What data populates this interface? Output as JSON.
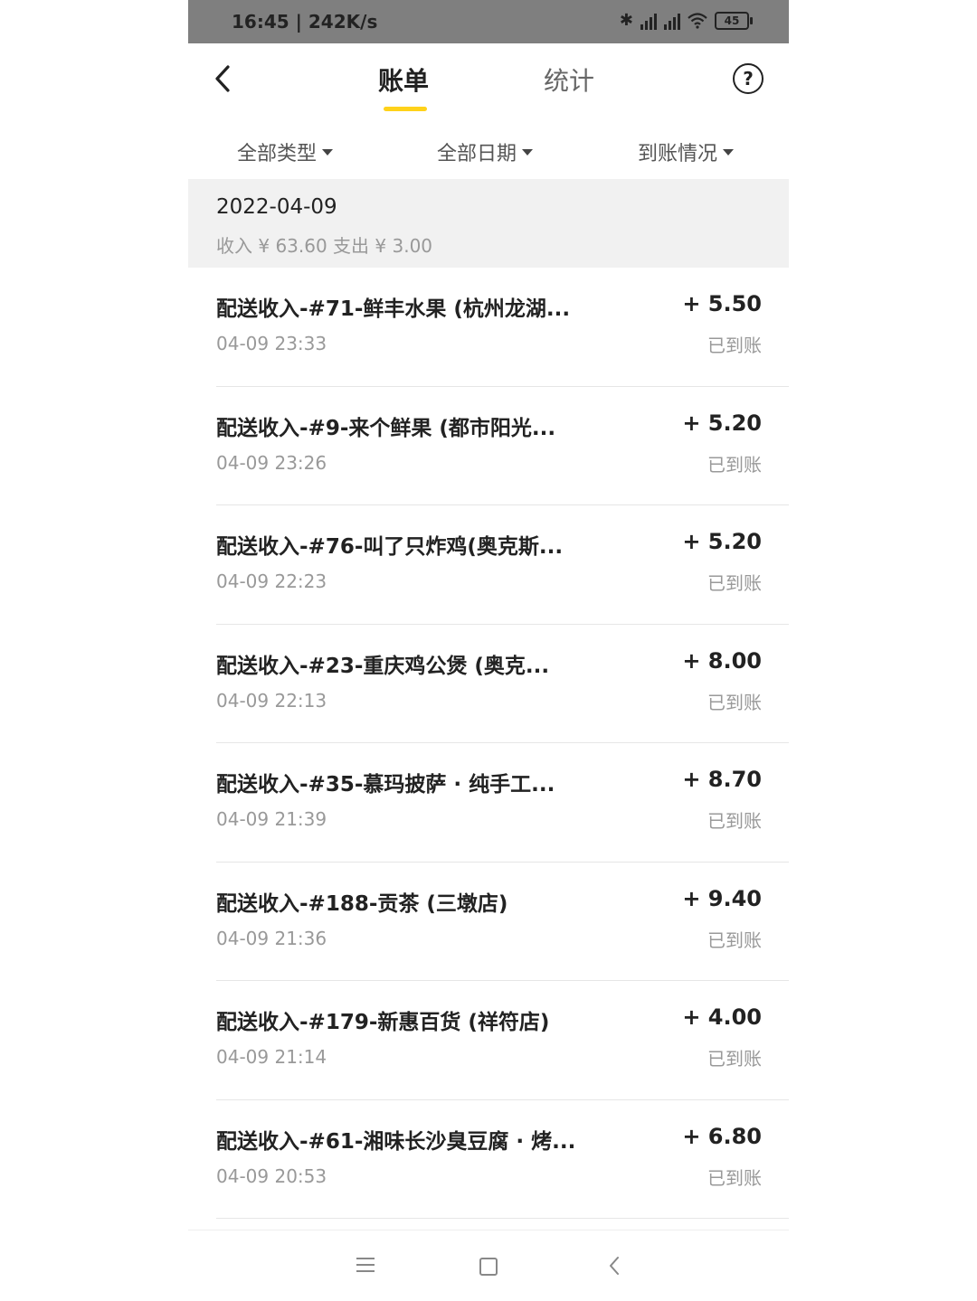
{
  "status_bar": {
    "time_speed": "16:45 | 242K/s",
    "battery": "45"
  },
  "header": {
    "tabs": [
      {
        "label": "账单",
        "active": true
      },
      {
        "label": "统计",
        "active": false
      }
    ]
  },
  "filters": [
    "全部类型",
    "全部日期",
    "到账情况"
  ],
  "date_group": {
    "date": "2022-04-09",
    "summary": "收入 ¥ 63.60 支出 ¥ 3.00"
  },
  "transactions": [
    {
      "title": "配送收入-#71-鲜丰水果 (杭州龙湖...",
      "time": "04-09 23:33",
      "amount": "+ 5.50",
      "status": "已到账"
    },
    {
      "title": "配送收入-#9-来个鲜果 (都市阳光...",
      "time": "04-09 23:26",
      "amount": "+ 5.20",
      "status": "已到账"
    },
    {
      "title": "配送收入-#76-叫了只炸鸡(奥克斯...",
      "time": "04-09 22:23",
      "amount": "+ 5.20",
      "status": "已到账"
    },
    {
      "title": "配送收入-#23-重庆鸡公煲 (奥克...",
      "time": "04-09 22:13",
      "amount": "+ 8.00",
      "status": "已到账"
    },
    {
      "title": "配送收入-#35-慕玛披萨 · 纯手工...",
      "time": "04-09 21:39",
      "amount": "+ 8.70",
      "status": "已到账"
    },
    {
      "title": "配送收入-#188-贡茶 (三墩店)",
      "time": "04-09 21:36",
      "amount": "+ 9.40",
      "status": "已到账"
    },
    {
      "title": "配送收入-#179-新惠百货 (祥符店)",
      "time": "04-09 21:14",
      "amount": "+ 4.00",
      "status": "已到账"
    },
    {
      "title": "配送收入-#61-湘味长沙臭豆腐 · 烤...",
      "time": "04-09 20:53",
      "amount": "+ 6.80",
      "status": "已到账"
    }
  ],
  "colors": {
    "accent": "#ffd21a",
    "status_bar_bg": "#7f7f7f",
    "date_band_bg": "#f1f1f1",
    "muted_text": "#999999"
  },
  "icons": [
    "back-icon",
    "help-icon",
    "bluetooth-icon",
    "signal-icon",
    "wifi-icon",
    "battery-icon",
    "nav-menu-icon",
    "nav-home-icon",
    "nav-back-icon"
  ]
}
